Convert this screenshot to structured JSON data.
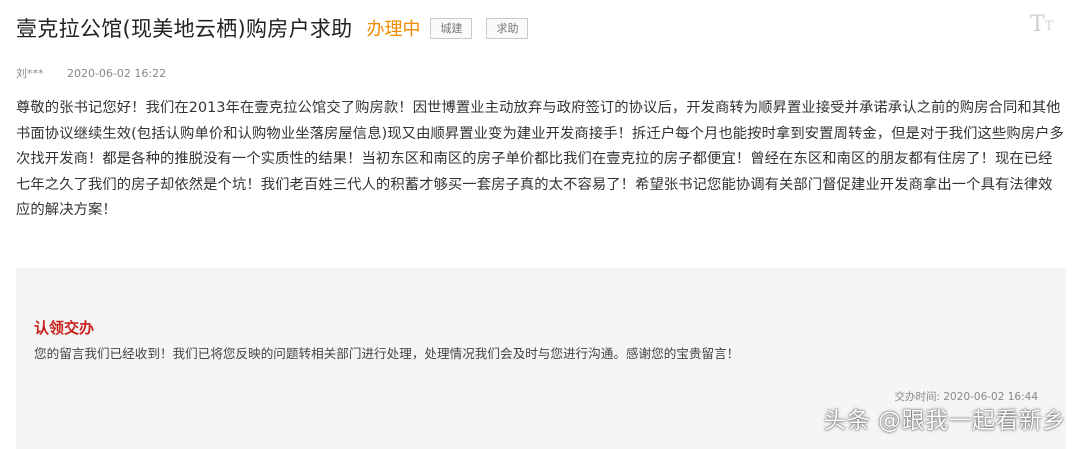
{
  "header": {
    "title": "壹克拉公馆(现美地云栖)购房户求助",
    "status": "办理中",
    "tags": [
      "城建",
      "求助"
    ],
    "font_toggle_icon": "text-size-icon"
  },
  "meta": {
    "author": "刘***",
    "datetime": "2020-06-02 16:22"
  },
  "message": {
    "body": "尊敬的张书记您好！我们在2013年在壹克拉公馆交了购房款！因世博置业主动放弃与政府签订的协议后，开发商转为顺昇置业接受并承诺承认之前的购房合同和其他书面协议继续生效(包括认购单价和认购物业坐落房屋信息)现又由顺昇置业变为建业开发商接手！拆迁户每个月也能按时拿到安置周转金，但是对于我们这些购房户多次找开发商！都是各种的推脱没有一个实质性的结果！当初东区和南区的房子单价都比我们在壹克拉的房子都便宜！曾经在东区和南区的朋友都有住房了！现在已经七年之久了我们的房子却依然是个坑！我们老百姓三代人的积蓄才够买一套房子真的太不容易了！希望张书记您能协调有关部门督促建业开发商拿出一个具有法律效应的解决方案！"
  },
  "reply": {
    "title": "认领交办",
    "text": "您的留言我们已经收到！我们已将您反映的问题转相关部门进行处理，处理情况我们会及时与您进行沟通。感谢您的宝贵留言！",
    "time_label": "交办时间:",
    "time": "2020-06-02 16:44"
  },
  "watermark": "头条 @跟我一起看新乡",
  "colors": {
    "status": "#f08a00",
    "reply_title": "#c8211f",
    "reply_bg": "#f5f5f5"
  }
}
